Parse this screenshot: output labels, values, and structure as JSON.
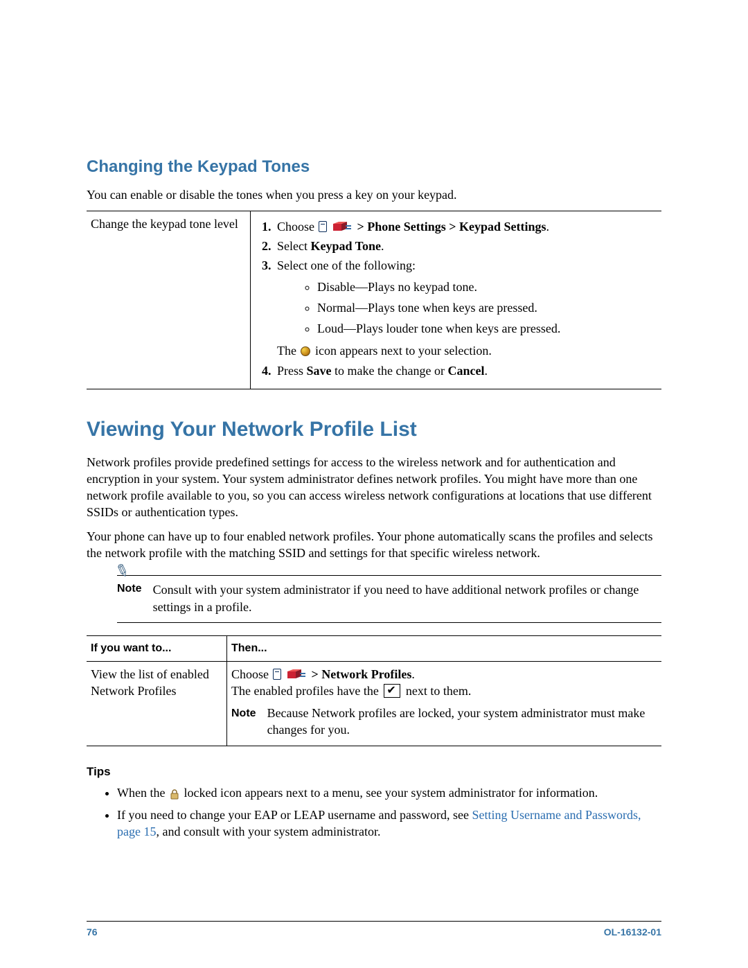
{
  "section1": {
    "heading": "Changing the Keypad Tones",
    "intro": "You can enable or disable the tones when you press a key on your keypad.",
    "left": "Change the keypad tone level",
    "step1_a": "Choose ",
    "step1_b": " > Phone Settings > Keypad Settings",
    "step1_c": ".",
    "step2_a": "Select ",
    "step2_b": "Keypad Tone",
    "step2_c": ".",
    "step3": "Select one of the following:",
    "opt1": "Disable—Plays no keypad tone.",
    "opt2": "Normal—Plays tone when keys are pressed.",
    "opt3": "Loud—Plays louder tone when keys are pressed.",
    "step3_tail_a": "The ",
    "step3_tail_b": " icon appears next to your selection.",
    "step4_a": "Press ",
    "step4_b": "Save",
    "step4_c": " to make the change or ",
    "step4_d": "Cancel",
    "step4_e": "."
  },
  "section2": {
    "heading": "Viewing Your Network Profile List",
    "p1": "Network profiles provide predefined settings for access to the wireless network and for authentication and encryption in your system. Your system administrator defines network profiles. You might have more than one network profile available to you, so you can access wireless network configurations at locations that use different SSIDs or authentication types.",
    "p2": "Your phone can have up to four enabled network profiles. Your phone automatically scans the profiles and selects the network profile with the matching SSID and settings for that specific wireless network.",
    "note_label": "Note",
    "note_text": "Consult with your system administrator if you need to have additional network profiles or change settings in a profile.",
    "col1": "If you want to...",
    "col2": "Then...",
    "row_left": "View the list of enabled Network Profiles",
    "row_r1_a": "Choose ",
    "row_r1_b": " > Network Profiles",
    "row_r1_c": ".",
    "row_r2_a": "The enabled profiles have the ",
    "row_r2_b": " next to them.",
    "row_note": "Because Network profiles are locked, your system administrator must make changes for you."
  },
  "tips": {
    "heading": "Tips",
    "t1_a": "When the ",
    "t1_b": " locked icon appears next to a menu, see your system administrator for information.",
    "t2_a": "If you need to change your EAP or LEAP username and password, see ",
    "t2_link": "Setting Username and Passwords, page 15",
    "t2_b": ", and consult with your system administrator."
  },
  "footer": {
    "page": "76",
    "doc": "OL-16132-01"
  }
}
